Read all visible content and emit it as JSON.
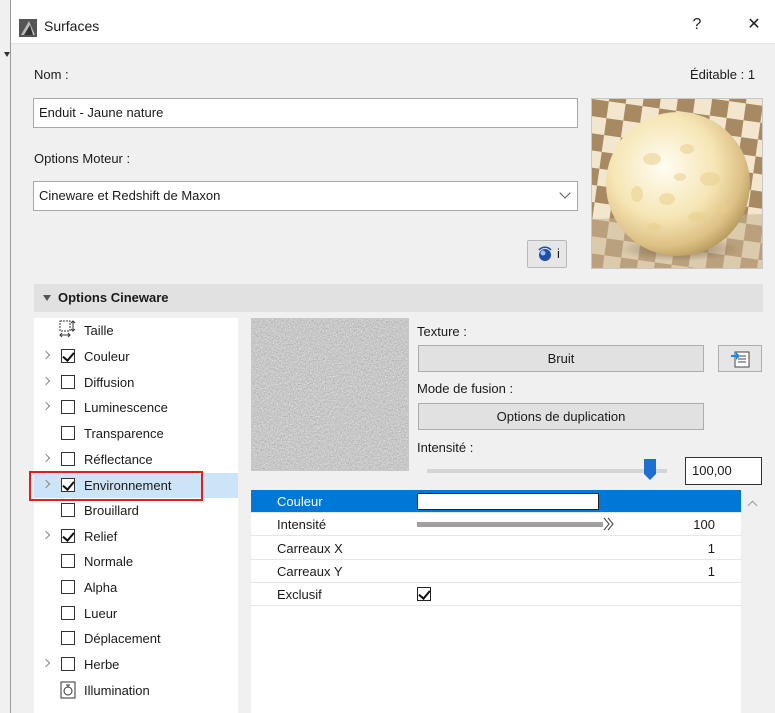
{
  "window": {
    "title": "Surfaces",
    "help_label": "?",
    "close_label": "✕"
  },
  "material": {
    "name_label": "Nom :",
    "editable_label": "Éditable : 1",
    "name_value": "Enduit - Jaune nature",
    "engine_label": "Options Moteur :",
    "engine_value": "Cineware et Redshift de Maxon",
    "info_button": "i"
  },
  "cineware": {
    "section_title": "Options Cineware",
    "channels": [
      {
        "label": "Taille",
        "expandable": false,
        "checkbox": "size-icon",
        "checked": false
      },
      {
        "label": "Couleur",
        "expandable": true,
        "checkbox": "box",
        "checked": true
      },
      {
        "label": "Diffusion",
        "expandable": true,
        "checkbox": "box",
        "checked": false
      },
      {
        "label": "Luminescence",
        "expandable": true,
        "checkbox": "box",
        "checked": false
      },
      {
        "label": "Transparence",
        "expandable": false,
        "checkbox": "box",
        "checked": false
      },
      {
        "label": "Réflectance",
        "expandable": true,
        "checkbox": "box",
        "checked": false
      },
      {
        "label": "Environnement",
        "expandable": true,
        "checkbox": "box",
        "checked": true,
        "selected": true
      },
      {
        "label": "Brouillard",
        "expandable": false,
        "checkbox": "box",
        "checked": false
      },
      {
        "label": "Relief",
        "expandable": true,
        "checkbox": "box",
        "checked": true
      },
      {
        "label": "Normale",
        "expandable": false,
        "checkbox": "box",
        "checked": false
      },
      {
        "label": "Alpha",
        "expandable": false,
        "checkbox": "box",
        "checked": false
      },
      {
        "label": "Lueur",
        "expandable": false,
        "checkbox": "box",
        "checked": false
      },
      {
        "label": "Déplacement",
        "expandable": false,
        "checkbox": "box",
        "checked": false
      },
      {
        "label": "Herbe",
        "expandable": true,
        "checkbox": "box",
        "checked": false
      },
      {
        "label": "Illumination",
        "expandable": false,
        "checkbox": "illumination-icon",
        "checked": false
      }
    ],
    "texture_label": "Texture :",
    "texture_value": "Bruit",
    "blend_label": "Mode de fusion :",
    "blend_value": "Options de duplication",
    "intensity_label": "Intensité :",
    "intensity_value": "100,00",
    "intensity_fraction": 0.93,
    "properties": [
      {
        "key": "Couleur",
        "type": "color",
        "color": "#ffffff",
        "selected": true
      },
      {
        "key": "Intensité",
        "type": "bar",
        "value": "100",
        "fraction": 1.0
      },
      {
        "key": "Carreaux X",
        "type": "text",
        "value": "1"
      },
      {
        "key": "Carreaux Y",
        "type": "text",
        "value": "1"
      },
      {
        "key": "Exclusif",
        "type": "checkbox",
        "checked": true
      }
    ]
  },
  "colors": {
    "accent": "#0078d7",
    "selection_bg": "#cce4f7",
    "highlight_box": "#e02020"
  }
}
